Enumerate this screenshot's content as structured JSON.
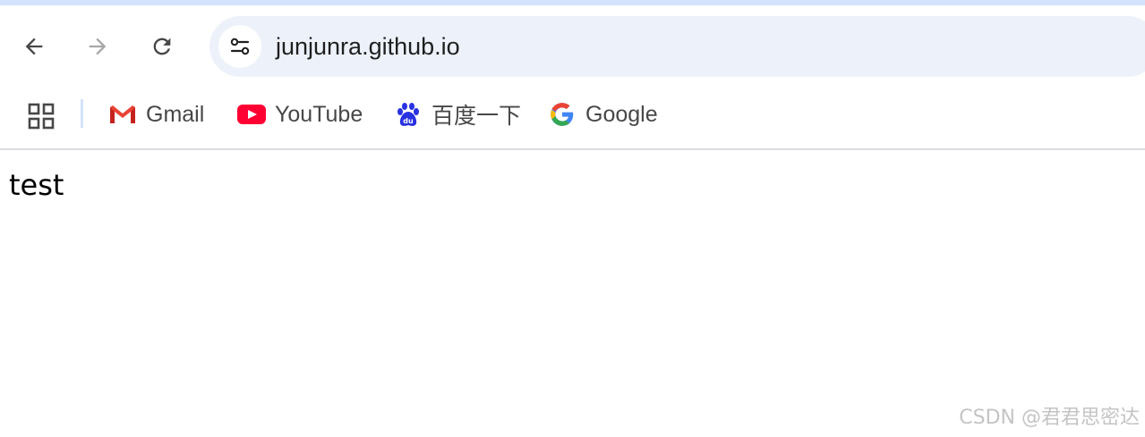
{
  "browser": {
    "url": "junjunra.github.io",
    "nav": {
      "back_icon": "arrow-left-icon",
      "forward_icon": "arrow-right-icon",
      "reload_icon": "reload-icon",
      "site_info_icon": "tune-icon"
    },
    "colors": {
      "omnibox_bg": "#edf2fa",
      "top_strip": "#d3e3fd",
      "youtube_red": "#ff0033",
      "baidu_blue": "#2932e1"
    }
  },
  "bookmarks": {
    "apps_icon": "apps-grid-icon",
    "items": [
      {
        "label": "Gmail",
        "icon": "gmail-icon"
      },
      {
        "label": "YouTube",
        "icon": "youtube-icon"
      },
      {
        "label": "百度一下",
        "icon": "baidu-icon"
      },
      {
        "label": "Google",
        "icon": "google-icon"
      }
    ]
  },
  "page": {
    "text": "test"
  },
  "watermark": "CSDN @君君思密达"
}
